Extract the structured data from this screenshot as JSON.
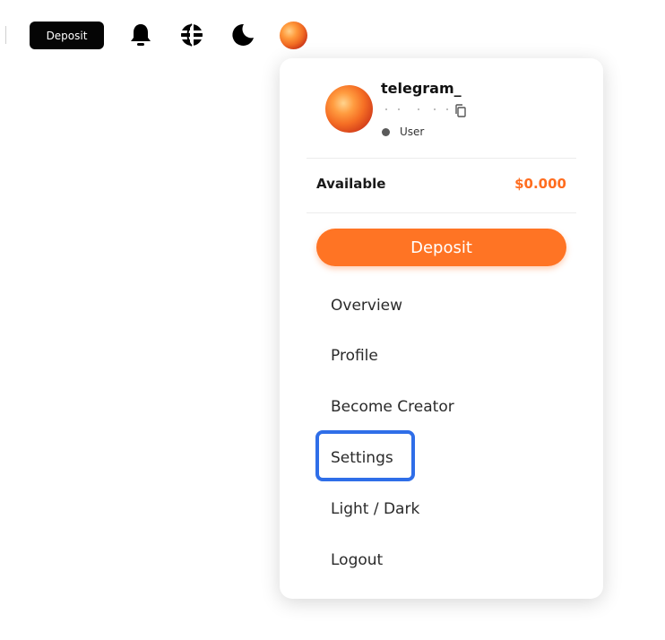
{
  "topbar": {
    "deposit_label": "Deposit",
    "icons": [
      "bell-icon",
      "globe-icon",
      "moon-icon",
      "avatar"
    ]
  },
  "account_menu": {
    "username": "telegram_",
    "role": "User",
    "balance": {
      "label": "Available",
      "value": "$0.000"
    },
    "deposit_label": "Deposit",
    "items": [
      {
        "label": "Overview"
      },
      {
        "label": "Profile"
      },
      {
        "label": "Become Creator"
      },
      {
        "label": "Settings",
        "highlighted": true
      },
      {
        "label": "Light / Dark"
      },
      {
        "label": "Logout"
      }
    ]
  },
  "colors": {
    "accent": "#ff7424",
    "balance": "#ff6d1f",
    "highlight": "#2f6ee8",
    "dark_button": "#050505"
  }
}
